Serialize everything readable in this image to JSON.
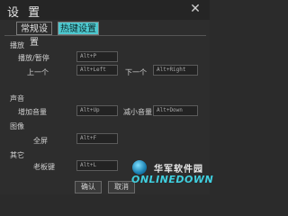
{
  "window": {
    "title": "设 置",
    "close_label": "✕"
  },
  "tabs": [
    {
      "label": "常规设置"
    },
    {
      "label": "热键设置"
    }
  ],
  "sections": {
    "playback": {
      "heading": "播放",
      "rows": [
        {
          "label": "播放/暂停",
          "value": "Alt+P"
        },
        {
          "label": "上一个",
          "value": "Alt+Left"
        },
        {
          "label": "下一个",
          "value": "Alt+Right"
        }
      ]
    },
    "volume": {
      "heading": "声音",
      "rows": [
        {
          "label": "增加音量",
          "value": "Alt+Up"
        },
        {
          "label": "减小音量",
          "value": "Alt+Down"
        }
      ]
    },
    "image": {
      "heading": "图像",
      "rows": [
        {
          "label": "全屏",
          "value": "Alt+F"
        }
      ]
    },
    "other": {
      "heading": "其它",
      "rows": [
        {
          "label": "老板键",
          "value": "Alt+L"
        }
      ]
    }
  },
  "buttons": {
    "ok": "确认",
    "cancel": "取消"
  },
  "watermark": {
    "top_text": "华军软件园",
    "bottom_text": "ONLINEDOWN"
  }
}
